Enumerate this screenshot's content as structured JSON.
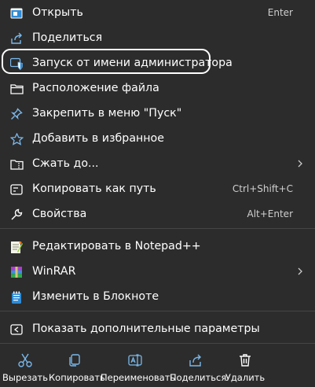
{
  "menu": {
    "items": [
      {
        "label": "Открыть",
        "shortcut": "Enter",
        "icon": "open-window-icon"
      },
      {
        "label": "Поделиться",
        "icon": "share-icon"
      },
      {
        "label": "Запуск от имени администратора",
        "icon": "admin-shield-icon"
      },
      {
        "label": "Расположение файла",
        "icon": "folder-icon"
      },
      {
        "label": "Закрепить в меню \"Пуск\"",
        "icon": "pin-icon"
      },
      {
        "label": "Добавить в избранное",
        "icon": "star-icon"
      },
      {
        "label": "Сжать до...",
        "icon": "compress-folder-icon",
        "has_submenu": true
      },
      {
        "label": "Копировать как путь",
        "shortcut": "Ctrl+Shift+C",
        "icon": "copy-path-icon"
      },
      {
        "label": "Свойства",
        "shortcut": "Alt+Enter",
        "icon": "wrench-icon"
      },
      {
        "label": "Редактировать в Notepad++",
        "icon": "notepadpp-icon"
      },
      {
        "label": "WinRAR",
        "icon": "winrar-icon",
        "has_submenu": true
      },
      {
        "label": "Изменить в Блокноте",
        "icon": "notepad-icon"
      },
      {
        "label": "Показать дополнительные параметры",
        "icon": "more-options-icon"
      }
    ]
  },
  "quick_actions": [
    {
      "label": "Вырезать",
      "icon": "scissors-icon"
    },
    {
      "label": "Копировать",
      "icon": "copy-icon"
    },
    {
      "label": "Переименовать",
      "icon": "rename-icon"
    },
    {
      "label": "Поделиться",
      "icon": "share-icon"
    },
    {
      "label": "Удалить",
      "icon": "trash-icon"
    }
  ],
  "colors": {
    "background": "#2c2c2c",
    "accent": "#60cdff",
    "highlight_ring": "#ffffff"
  }
}
